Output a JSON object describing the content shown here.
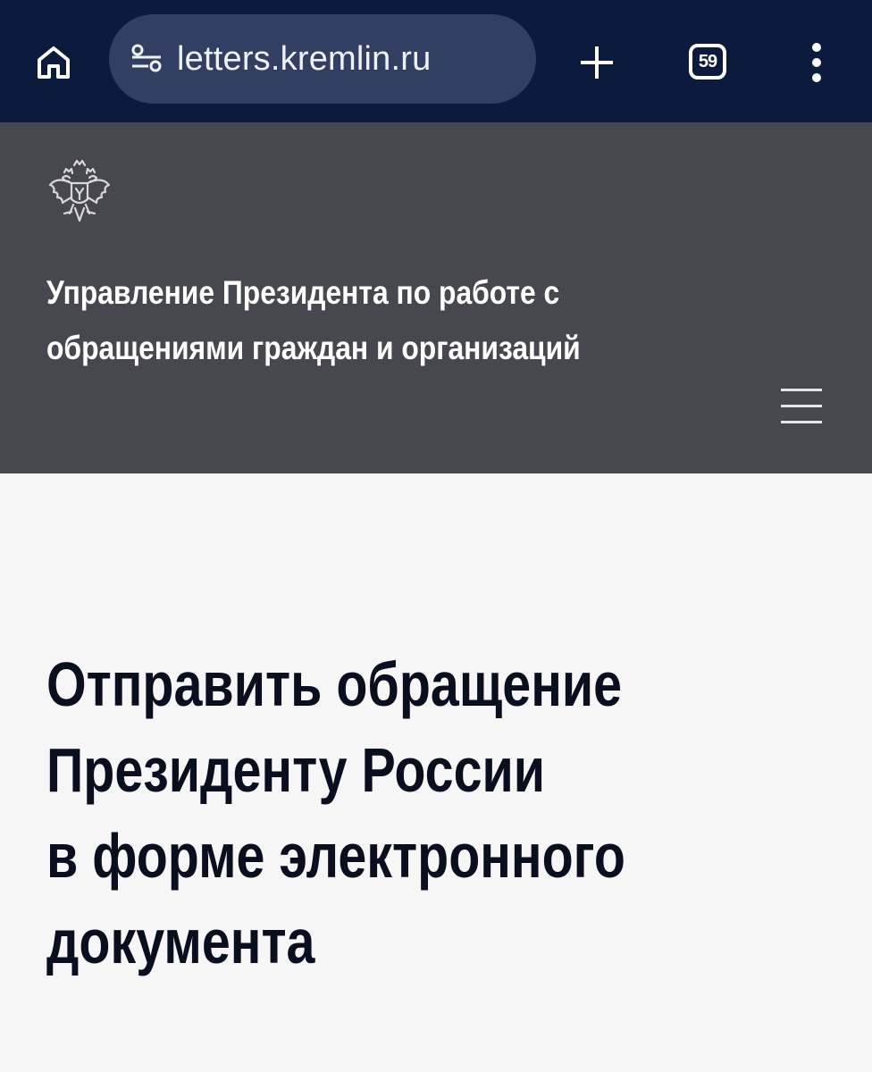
{
  "browser": {
    "url": "letters.kremlin.ru",
    "tab_count": "59",
    "colors": {
      "toolbar": "#0c1a3d",
      "url_pill": "#323f63"
    },
    "icons": [
      "home-icon",
      "site-info-icon",
      "plus-icon",
      "tabs-icon",
      "more-vert-icon"
    ]
  },
  "header": {
    "org_name": "Управление Президента по работе с обращениями граждан и организаций",
    "emblem_icon": "double-headed-eagle-emblem-icon",
    "menu_icon": "hamburger-menu-icon",
    "colors": {
      "background": "#46474f",
      "text": "#ffffff"
    }
  },
  "main": {
    "title_lines": [
      "Отправить обращение",
      "Президенту России",
      "в форме электронного",
      "документа"
    ],
    "colors": {
      "background": "#f6f6f6",
      "title": "#0a0f1f"
    }
  }
}
